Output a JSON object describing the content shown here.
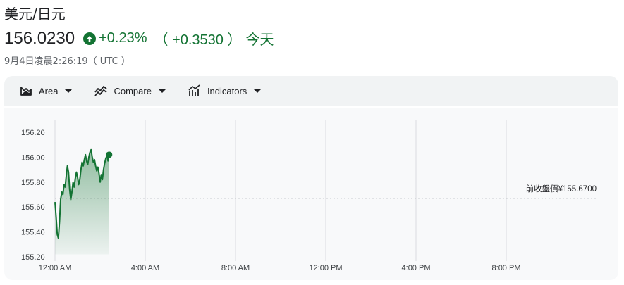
{
  "header": {
    "pair": "美元/日元",
    "price": "156.0230",
    "change_percent": "+0.23%",
    "change_abs": "（ +0.3530 ）",
    "period": "今天",
    "timestamp": "9月4日凌晨2:26:19（ UTC ）",
    "icon": "arrow-up-circle-icon",
    "up_color": "#137333"
  },
  "toolbar": {
    "area_label": "Area",
    "compare_label": "Compare",
    "indicators_label": "Indicators"
  },
  "chart_data": {
    "type": "area",
    "title": "",
    "xlabel": "",
    "ylabel": "",
    "ylim": [
      155.2,
      156.2
    ],
    "y_ticks": [
      "156.20",
      "156.00",
      "155.80",
      "155.60",
      "155.40",
      "155.20"
    ],
    "x_ticks": [
      "12:00 AM",
      "4:00 AM",
      "8:00 AM",
      "12:00 PM",
      "4:00 PM",
      "8:00 PM"
    ],
    "x_range_hours": [
      0,
      24
    ],
    "previous_close": 155.67,
    "previous_close_label": "前收盤價¥155.6700",
    "line_color": "#137333",
    "series": [
      {
        "values": [
          [
            0.0,
            155.64
          ],
          [
            0.05,
            155.52
          ],
          [
            0.1,
            155.38
          ],
          [
            0.15,
            155.35
          ],
          [
            0.2,
            155.48
          ],
          [
            0.25,
            155.66
          ],
          [
            0.3,
            155.72
          ],
          [
            0.35,
            155.7
          ],
          [
            0.4,
            155.78
          ],
          [
            0.45,
            155.76
          ],
          [
            0.5,
            155.85
          ],
          [
            0.55,
            155.93
          ],
          [
            0.6,
            155.88
          ],
          [
            0.65,
            155.74
          ],
          [
            0.7,
            155.66
          ],
          [
            0.75,
            155.72
          ],
          [
            0.8,
            155.8
          ],
          [
            0.85,
            155.76
          ],
          [
            0.9,
            155.83
          ],
          [
            0.95,
            155.88
          ],
          [
            1.0,
            155.84
          ],
          [
            1.05,
            155.78
          ],
          [
            1.1,
            155.82
          ],
          [
            1.15,
            155.9
          ],
          [
            1.2,
            155.96
          ],
          [
            1.25,
            155.93
          ],
          [
            1.3,
            155.98
          ],
          [
            1.35,
            156.02
          ],
          [
            1.4,
            155.97
          ],
          [
            1.45,
            155.94
          ],
          [
            1.5,
            156.0
          ],
          [
            1.55,
            156.04
          ],
          [
            1.6,
            156.06
          ],
          [
            1.65,
            156.0
          ],
          [
            1.7,
            155.96
          ],
          [
            1.75,
            155.98
          ],
          [
            1.8,
            155.93
          ],
          [
            1.85,
            155.89
          ],
          [
            1.9,
            155.92
          ],
          [
            1.95,
            155.87
          ],
          [
            2.0,
            155.8
          ],
          [
            2.05,
            155.86
          ],
          [
            2.1,
            155.82
          ],
          [
            2.15,
            155.9
          ],
          [
            2.2,
            155.95
          ],
          [
            2.25,
            155.99
          ],
          [
            2.3,
            156.01
          ],
          [
            2.35,
            155.97
          ],
          [
            2.4,
            156.02
          ]
        ]
      }
    ]
  }
}
